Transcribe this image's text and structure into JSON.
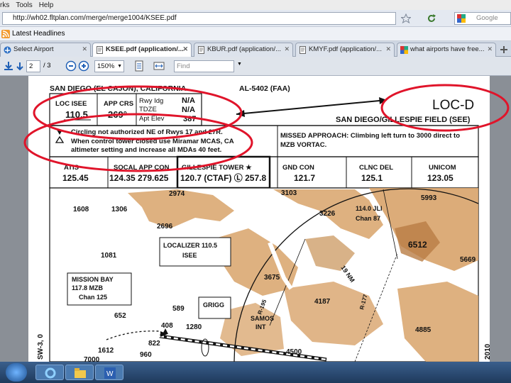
{
  "menu": [
    "rks",
    "Tools",
    "Help"
  ],
  "address": {
    "url": "http://wh02.fltplan.com/merge/merge1004/KSEE.pdf",
    "search_placeholder": "Google"
  },
  "bookmarks": {
    "latest_headlines": "Latest Headlines"
  },
  "tabs": [
    {
      "label": "Select Airport",
      "active": false
    },
    {
      "label": "KSEE.pdf (application/...",
      "active": true
    },
    {
      "label": "KBUR.pdf (application/...",
      "active": false
    },
    {
      "label": "KMYF.pdf (application/...",
      "active": false
    },
    {
      "label": "what airports have free...",
      "active": false
    }
  ],
  "pdf_toolbar": {
    "page_current": "2",
    "page_total": "/ 3",
    "zoom": "150%",
    "find_placeholder": "Find"
  },
  "chart": {
    "location": "SAN DIEGO (EL CAJON), CALIFORNIA",
    "procedure_number": "AL-5402 (FAA)",
    "loc_label": "LOC ISEE",
    "loc_freq": "110.5",
    "app_crs_label": "APP CRS",
    "app_crs": "269°",
    "rwy_ldg_label": "Rwy Idg",
    "tdze_label": "TDZE",
    "apt_elev_label": "Apt Elev",
    "rwy_ldg_value": "N/A",
    "tdze_value": "N/A",
    "apt_elev_value": "387",
    "procedure_title": "LOC-D",
    "airport_name": "SAN DIEGO/GILLESPIE FIELD (SEE)",
    "notes_line1": "Circling not authorized NE of Rwys 17 and 27R.",
    "notes_line2": "When control tower closed use Miramar MCAS, CA",
    "notes_line3": "altimeter setting and increase all MDAs 40 feet.",
    "missed_line1": "MISSED APPROACH: Climbing left turn to 3000 direct to",
    "missed_line2": "MZB VORTAC.",
    "freqs": [
      {
        "label": "ATIS",
        "value": "125.45"
      },
      {
        "label": "SOCAL APP CON",
        "value": "124.35  279.625"
      },
      {
        "label": "GILLESPIE TOWER ★",
        "value": "120.7 (CTAF) Ⓛ  257.8"
      },
      {
        "label": "GND CON",
        "value": "121.7"
      },
      {
        "label": "CLNC DEL",
        "value": "125.1"
      },
      {
        "label": "UNICOM",
        "value": "123.05"
      }
    ],
    "map_labels": {
      "e2974": "2974",
      "e3103": "3103",
      "e5993": "5993",
      "e1608": "1608",
      "e1306": "1306",
      "e3226": "3226",
      "jul_freq": "114.0 JLI",
      "jul_chan": "Chan 87",
      "e2696": "2696",
      "loc_box1": "LOCALIZER 110.5",
      "loc_box2": "ISEE",
      "e6512": "6512",
      "e1081": "1081",
      "e3675": "3675",
      "e5669": "5669",
      "nm19": "19 NM",
      "mb1": "MISSION BAY",
      "mb2": "117.8 MZB",
      "mb3": "Chan 125",
      "e589": "589",
      "grigg": "GRIGG",
      "e4187": "4187",
      "e652": "652",
      "samos": "SAMOS",
      "int": "INT",
      "r195": "R-195",
      "r177": "R-177",
      "e408": "408",
      "e1280": "1280",
      "e4885": "4885",
      "e822": "822",
      "e1612": "1612",
      "e960": "960",
      "e4500": "4500",
      "e7000": "7000",
      "sw3": "SW-3, 0",
      "yr2010": "2010"
    }
  },
  "colors": {
    "terrain": "#d8a36a",
    "annotation": "#e0142a",
    "accent": "#1f5fb5"
  }
}
